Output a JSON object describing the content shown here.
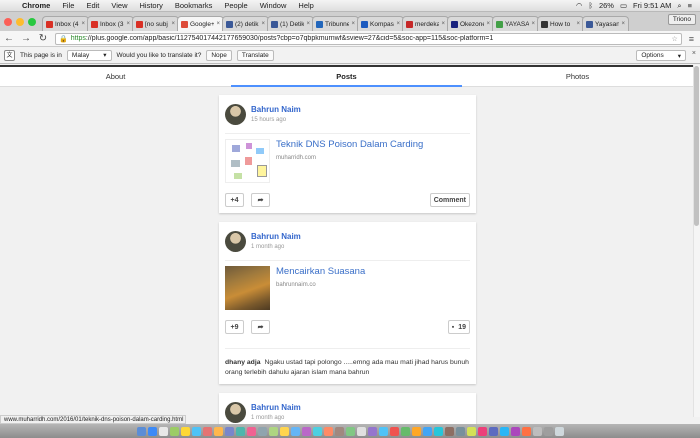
{
  "menubar": {
    "app": "Chrome",
    "items": [
      "File",
      "Edit",
      "View",
      "History",
      "Bookmarks",
      "People",
      "Window",
      "Help"
    ],
    "battery": "26%",
    "clock": "Fri 9:51 AM"
  },
  "tabs": [
    {
      "label": "Inbox (4",
      "color": "#d93025"
    },
    {
      "label": "Inbox (3",
      "color": "#d93025"
    },
    {
      "label": "[no subj",
      "color": "#d93025"
    },
    {
      "label": "Google+",
      "color": "#dd4b39",
      "active": true
    },
    {
      "label": "(2) detik",
      "color": "#3b5998"
    },
    {
      "label": "(1) Detik",
      "color": "#3b5998"
    },
    {
      "label": "Tribunne",
      "color": "#2266bb"
    },
    {
      "label": "Kompas",
      "color": "#1d5bbf"
    },
    {
      "label": "merdeka",
      "color": "#c62828"
    },
    {
      "label": "Okezone",
      "color": "#1a237e"
    },
    {
      "label": "YAYASAN",
      "color": "#43a047"
    },
    {
      "label": "How to",
      "color": "#333333"
    },
    {
      "label": "Yayasan",
      "color": "#3b5998"
    }
  ],
  "profile": "Triono",
  "address": {
    "scheme": "https",
    "rest": "://plus.google.com/app/basic/112754017442177659030/posts?cbp=o7qbpkmurnwf&sview=27&cid=5&soc-app=115&soc-platform=1"
  },
  "translate": {
    "prefix": "This page is in",
    "language": "Malay",
    "question": "Would you like to translate it?",
    "nope": "Nope",
    "translate": "Translate",
    "options": "Options"
  },
  "nav_tabs": {
    "about": "About",
    "posts": "Posts",
    "photos": "Photos"
  },
  "posts": [
    {
      "author": "Bahrun Naim",
      "time": "15 hours ago",
      "link_title": "Teknik DNS Poison Dalam Carding",
      "link_site": "muharridh.com",
      "plus": "+4",
      "comment_btn": "Comment"
    },
    {
      "author": "Bahrun Naim",
      "time": "1 month ago",
      "link_title": "Mencairkan Suasana",
      "link_site": "bahrunnaim.co",
      "plus": "+9",
      "comment_count": "19",
      "comment_author": "dhany adja",
      "comment_text": "Ngaku ustad tapi polongo .....emng ada mau mati jihad harus bunuh orang terlebih dahulu ajaran islam mana bahrun"
    },
    {
      "author": "Bahrun Naim",
      "time": "1 month ago"
    }
  ],
  "status_url": "www.muharridh.com/2016/01/teknik-dns-poison-dalam-carding.html",
  "dock_colors": [
    "#5b8dd6",
    "#3d8af7",
    "#e8e8e8",
    "#9ccc65",
    "#fdd835",
    "#4fc3f7",
    "#e57373",
    "#ffb74d",
    "#7986cb",
    "#4db6ac",
    "#f06292",
    "#90a4ae",
    "#aed581",
    "#ffd54f",
    "#64b5f6",
    "#ba68c8",
    "#4dd0e1",
    "#ff8a65",
    "#a1887f",
    "#81c784",
    "#e0e0e0",
    "#9575cd",
    "#4fc3f7",
    "#ef5350",
    "#66bb6a",
    "#ffa726",
    "#42a5f5",
    "#26c6da",
    "#8d6e63",
    "#78909c",
    "#d4e157",
    "#ec407a",
    "#5c6bc0",
    "#29b6f6",
    "#ab47bc",
    "#ff7043",
    "#bdbdbd",
    "#9e9e9e",
    "#cfd8dc"
  ]
}
